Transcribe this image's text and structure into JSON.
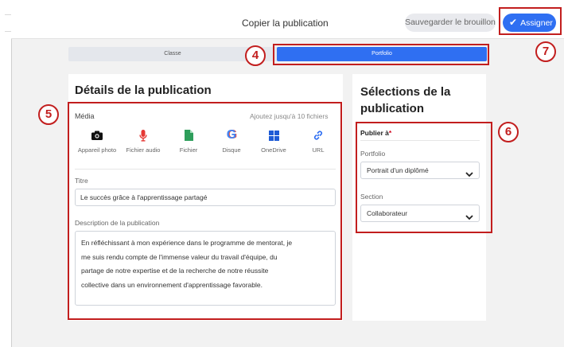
{
  "header": {
    "title": "Copier la publication",
    "draft_button": "Sauvegarder le brouillon",
    "assign_button": "Assigner"
  },
  "tabs": [
    {
      "label": "Classe",
      "active": false
    },
    {
      "label": "Portfolio",
      "active": true
    }
  ],
  "left_panel": {
    "heading": "Détails de la publication",
    "media": {
      "label": "Média",
      "hint": "Ajoutez jusqu'à 10 fichiers",
      "items": [
        {
          "label": "Appareil photo",
          "icon": "camera-icon"
        },
        {
          "label": "Fichier audio",
          "icon": "microphone-icon"
        },
        {
          "label": "Fichier",
          "icon": "file-icon"
        },
        {
          "label": "Disque",
          "icon": "google-drive-icon"
        },
        {
          "label": "OneDrive",
          "icon": "onedrive-icon"
        },
        {
          "label": "URL",
          "icon": "link-icon"
        }
      ]
    },
    "title_label": "Titre",
    "title_value": "Le succès grâce à l'apprentissage partagé",
    "description_label": "Description de la publication",
    "description_lines": [
      "En réfléchissant à mon expérience dans le programme de mentorat, je",
      "me suis rendu compte de l'immense valeur du travail d'équipe, du",
      "partage de notre expertise et de la recherche de notre réussite",
      "collective dans un environnement d'apprentissage favorable."
    ]
  },
  "right_panel": {
    "heading": "Sélections de la publication",
    "publish_to": "Publier à",
    "required_mark": "*",
    "portfolio_label": "Portfolio",
    "portfolio_value": "Portrait d'un diplômé",
    "section_label": "Section",
    "section_value": "Collaborateur"
  },
  "callouts": [
    "4",
    "5",
    "6",
    "7"
  ],
  "colors": {
    "accent": "#2f6ff2",
    "callout": "#c21e1e",
    "microphone": "#e53935",
    "file": "#2e9e5b"
  }
}
